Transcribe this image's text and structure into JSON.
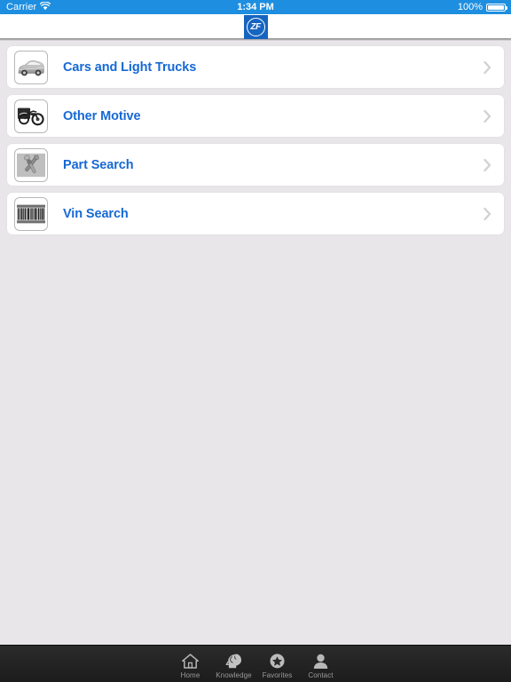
{
  "status_bar": {
    "carrier": "Carrier",
    "wifi_icon": "wifi-icon",
    "time": "1:34 PM",
    "battery_percent": "100%",
    "battery_icon": "battery-full-icon",
    "background_color": "#1e8ee0",
    "text_color": "#ffffff"
  },
  "nav_bar": {
    "logo_text": "ZF",
    "logo_icon": "zf-logo-icon",
    "logo_color": "#1565c0",
    "background_color": "#ffffff"
  },
  "main": {
    "background_color": "#e8e6e8",
    "accent_color": "#1669d4",
    "rows": [
      {
        "label": "Cars and Light Trucks",
        "icon": "car-icon",
        "chevron": "chevron-right-icon"
      },
      {
        "label": "Other Motive",
        "icon": "motorcycle-icon",
        "chevron": "chevron-right-icon"
      },
      {
        "label": "Part Search",
        "icon": "wrench-tools-icon",
        "chevron": "chevron-right-icon"
      },
      {
        "label": "Vin Search",
        "icon": "barcode-icon",
        "chevron": "chevron-right-icon"
      }
    ]
  },
  "tab_bar": {
    "background_color": "#222222",
    "label_color": "#9a9a9a",
    "items": [
      {
        "label": "Home",
        "icon": "home-icon"
      },
      {
        "label": "Knowledge",
        "icon": "head-brain-icon"
      },
      {
        "label": "Favorites",
        "icon": "star-circle-icon"
      },
      {
        "label": "Contact",
        "icon": "person-icon"
      }
    ]
  }
}
